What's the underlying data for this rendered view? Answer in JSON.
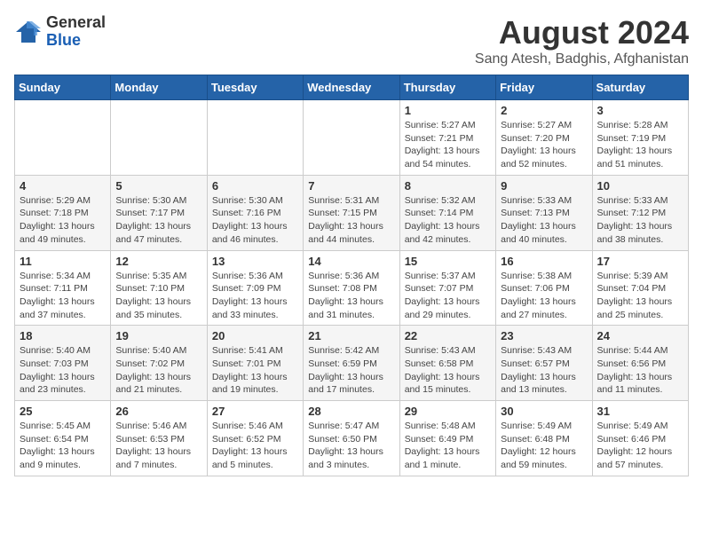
{
  "header": {
    "logo_line1": "General",
    "logo_line2": "Blue",
    "month_title": "August 2024",
    "location": "Sang Atesh, Badghis, Afghanistan"
  },
  "weekdays": [
    "Sunday",
    "Monday",
    "Tuesday",
    "Wednesday",
    "Thursday",
    "Friday",
    "Saturday"
  ],
  "weeks": [
    [
      {
        "day": "",
        "info": ""
      },
      {
        "day": "",
        "info": ""
      },
      {
        "day": "",
        "info": ""
      },
      {
        "day": "",
        "info": ""
      },
      {
        "day": "1",
        "info": "Sunrise: 5:27 AM\nSunset: 7:21 PM\nDaylight: 13 hours\nand 54 minutes."
      },
      {
        "day": "2",
        "info": "Sunrise: 5:27 AM\nSunset: 7:20 PM\nDaylight: 13 hours\nand 52 minutes."
      },
      {
        "day": "3",
        "info": "Sunrise: 5:28 AM\nSunset: 7:19 PM\nDaylight: 13 hours\nand 51 minutes."
      }
    ],
    [
      {
        "day": "4",
        "info": "Sunrise: 5:29 AM\nSunset: 7:18 PM\nDaylight: 13 hours\nand 49 minutes."
      },
      {
        "day": "5",
        "info": "Sunrise: 5:30 AM\nSunset: 7:17 PM\nDaylight: 13 hours\nand 47 minutes."
      },
      {
        "day": "6",
        "info": "Sunrise: 5:30 AM\nSunset: 7:16 PM\nDaylight: 13 hours\nand 46 minutes."
      },
      {
        "day": "7",
        "info": "Sunrise: 5:31 AM\nSunset: 7:15 PM\nDaylight: 13 hours\nand 44 minutes."
      },
      {
        "day": "8",
        "info": "Sunrise: 5:32 AM\nSunset: 7:14 PM\nDaylight: 13 hours\nand 42 minutes."
      },
      {
        "day": "9",
        "info": "Sunrise: 5:33 AM\nSunset: 7:13 PM\nDaylight: 13 hours\nand 40 minutes."
      },
      {
        "day": "10",
        "info": "Sunrise: 5:33 AM\nSunset: 7:12 PM\nDaylight: 13 hours\nand 38 minutes."
      }
    ],
    [
      {
        "day": "11",
        "info": "Sunrise: 5:34 AM\nSunset: 7:11 PM\nDaylight: 13 hours\nand 37 minutes."
      },
      {
        "day": "12",
        "info": "Sunrise: 5:35 AM\nSunset: 7:10 PM\nDaylight: 13 hours\nand 35 minutes."
      },
      {
        "day": "13",
        "info": "Sunrise: 5:36 AM\nSunset: 7:09 PM\nDaylight: 13 hours\nand 33 minutes."
      },
      {
        "day": "14",
        "info": "Sunrise: 5:36 AM\nSunset: 7:08 PM\nDaylight: 13 hours\nand 31 minutes."
      },
      {
        "day": "15",
        "info": "Sunrise: 5:37 AM\nSunset: 7:07 PM\nDaylight: 13 hours\nand 29 minutes."
      },
      {
        "day": "16",
        "info": "Sunrise: 5:38 AM\nSunset: 7:06 PM\nDaylight: 13 hours\nand 27 minutes."
      },
      {
        "day": "17",
        "info": "Sunrise: 5:39 AM\nSunset: 7:04 PM\nDaylight: 13 hours\nand 25 minutes."
      }
    ],
    [
      {
        "day": "18",
        "info": "Sunrise: 5:40 AM\nSunset: 7:03 PM\nDaylight: 13 hours\nand 23 minutes."
      },
      {
        "day": "19",
        "info": "Sunrise: 5:40 AM\nSunset: 7:02 PM\nDaylight: 13 hours\nand 21 minutes."
      },
      {
        "day": "20",
        "info": "Sunrise: 5:41 AM\nSunset: 7:01 PM\nDaylight: 13 hours\nand 19 minutes."
      },
      {
        "day": "21",
        "info": "Sunrise: 5:42 AM\nSunset: 6:59 PM\nDaylight: 13 hours\nand 17 minutes."
      },
      {
        "day": "22",
        "info": "Sunrise: 5:43 AM\nSunset: 6:58 PM\nDaylight: 13 hours\nand 15 minutes."
      },
      {
        "day": "23",
        "info": "Sunrise: 5:43 AM\nSunset: 6:57 PM\nDaylight: 13 hours\nand 13 minutes."
      },
      {
        "day": "24",
        "info": "Sunrise: 5:44 AM\nSunset: 6:56 PM\nDaylight: 13 hours\nand 11 minutes."
      }
    ],
    [
      {
        "day": "25",
        "info": "Sunrise: 5:45 AM\nSunset: 6:54 PM\nDaylight: 13 hours\nand 9 minutes."
      },
      {
        "day": "26",
        "info": "Sunrise: 5:46 AM\nSunset: 6:53 PM\nDaylight: 13 hours\nand 7 minutes."
      },
      {
        "day": "27",
        "info": "Sunrise: 5:46 AM\nSunset: 6:52 PM\nDaylight: 13 hours\nand 5 minutes."
      },
      {
        "day": "28",
        "info": "Sunrise: 5:47 AM\nSunset: 6:50 PM\nDaylight: 13 hours\nand 3 minutes."
      },
      {
        "day": "29",
        "info": "Sunrise: 5:48 AM\nSunset: 6:49 PM\nDaylight: 13 hours\nand 1 minute."
      },
      {
        "day": "30",
        "info": "Sunrise: 5:49 AM\nSunset: 6:48 PM\nDaylight: 12 hours\nand 59 minutes."
      },
      {
        "day": "31",
        "info": "Sunrise: 5:49 AM\nSunset: 6:46 PM\nDaylight: 12 hours\nand 57 minutes."
      }
    ]
  ]
}
